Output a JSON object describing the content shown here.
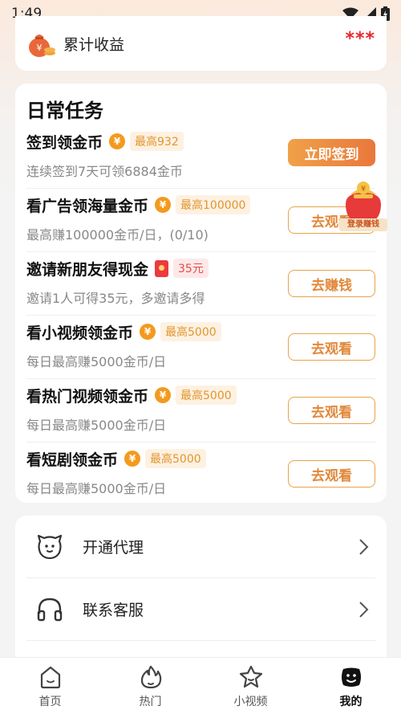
{
  "status_bar": {
    "time": "1:49"
  },
  "earnings": {
    "title": "累计收益",
    "value": "***"
  },
  "tasks": {
    "title": "日常任务",
    "items": [
      {
        "name": "签到领金币",
        "icon": "coin-icon",
        "badge": "最高932",
        "desc": "连续签到7天可领6884金币",
        "button": "立即签到"
      },
      {
        "name": "看广告领海量金币",
        "icon": "coin-icon",
        "badge": "最高100000",
        "desc": "最高赚100000金币/日，(0/10)",
        "button": "去观看"
      },
      {
        "name": "邀请新朋友得现金",
        "icon": "red-packet-icon",
        "badge": "35元",
        "desc": "邀请1人可得35元，多邀请多得",
        "button": "去赚钱"
      },
      {
        "name": "看小视频领金币",
        "icon": "coin-icon",
        "badge": "最高5000",
        "desc": "每日最高赚5000金币/日",
        "button": "去观看"
      },
      {
        "name": "看热门视频领金币",
        "icon": "coin-icon",
        "badge": "最高5000",
        "desc": "每日最高赚5000金币/日",
        "button": "去观看"
      },
      {
        "name": "看短剧领金币",
        "icon": "coin-icon",
        "badge": "最高5000",
        "desc": "每日最高赚5000金币/日",
        "button": "去观看"
      }
    ]
  },
  "login_float": {
    "label": "登录赚钱"
  },
  "menu": {
    "items": [
      {
        "label": "开通代理",
        "icon": "smiley-face-icon"
      },
      {
        "label": "联系客服",
        "icon": "headphones-icon"
      }
    ]
  },
  "bottom_nav": {
    "items": [
      {
        "label": "首页",
        "icon": "home-icon"
      },
      {
        "label": "热门",
        "icon": "flame-icon"
      },
      {
        "label": "小视频",
        "icon": "star-icon"
      },
      {
        "label": "我的",
        "icon": "profile-face-icon"
      }
    ]
  },
  "colors": {
    "accent": "#e9773b",
    "price_red": "#e8262b",
    "badge_orange": "#e3952d"
  }
}
